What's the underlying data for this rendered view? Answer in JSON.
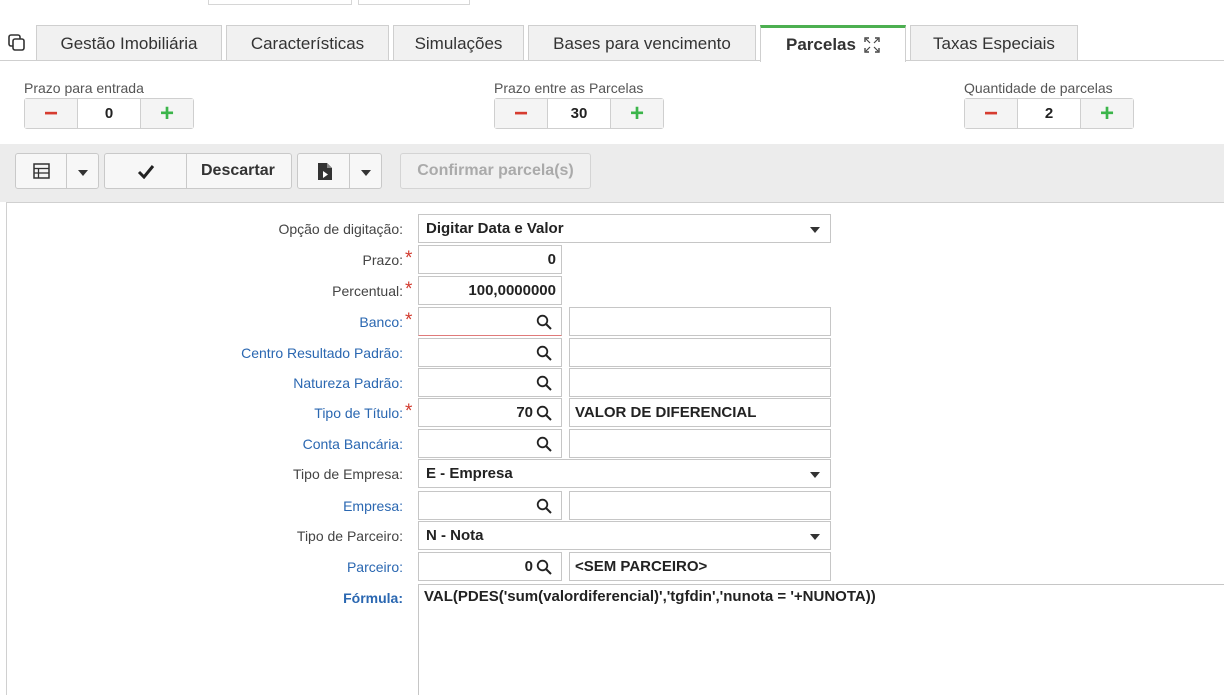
{
  "tabs": [
    {
      "label": "Gestão Imobiliária"
    },
    {
      "label": "Características"
    },
    {
      "label": "Simulações"
    },
    {
      "label": "Bases para vencimento"
    },
    {
      "label": "Parcelas"
    },
    {
      "label": "Taxas Especiais"
    }
  ],
  "steppers": {
    "entrada": {
      "label": "Prazo para entrada",
      "value": "0"
    },
    "entre": {
      "label": "Prazo entre as Parcelas",
      "value": "30"
    },
    "qtd": {
      "label": "Quantidade de parcelas",
      "value": "2"
    }
  },
  "toolbar": {
    "descartar": "Descartar",
    "confirmar": "Confirmar parcela(s)"
  },
  "form": {
    "opcao": {
      "label": "Opção de digitação:",
      "value": "Digitar Data e Valor"
    },
    "prazo": {
      "label": "Prazo:",
      "value": "0"
    },
    "percentual": {
      "label": "Percentual:",
      "value": "100,0000000"
    },
    "banco": {
      "label": "Banco:",
      "code": "",
      "desc": ""
    },
    "centro": {
      "label": "Centro Resultado Padrão:",
      "code": "",
      "desc": ""
    },
    "natureza": {
      "label": "Natureza Padrão:",
      "code": "",
      "desc": ""
    },
    "tipotitulo": {
      "label": "Tipo de Título:",
      "code": "70",
      "desc": "VALOR DE DIFERENCIAL"
    },
    "conta": {
      "label": "Conta Bancária:",
      "code": "",
      "desc": ""
    },
    "tipoempresa": {
      "label": "Tipo de Empresa:",
      "value": "E - Empresa"
    },
    "empresa": {
      "label": "Empresa:",
      "code": "",
      "desc": ""
    },
    "tipoparceiro": {
      "label": "Tipo de Parceiro:",
      "value": "N - Nota"
    },
    "parceiro": {
      "label": "Parceiro:",
      "code": "0",
      "desc": "<SEM PARCEIRO>"
    },
    "formula": {
      "label": "Fórmula:",
      "value": "VAL(PDES('sum(valordiferencial)','tgfdin','nunota = '+NUNOTA))"
    }
  },
  "colors": {
    "accent": "#4caf50",
    "minus": "#d63c2f",
    "plus": "#3bb54a",
    "link": "#2a67b1",
    "required": "#d23a2e"
  }
}
